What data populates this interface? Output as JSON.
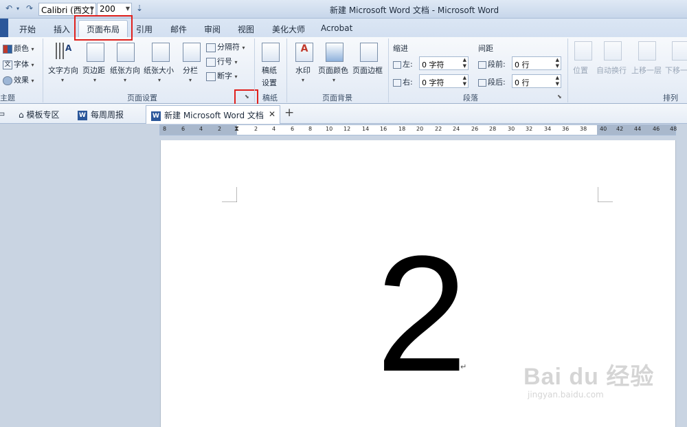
{
  "quick_access": {
    "undo_glyph": "↶",
    "undo_caret": "▾",
    "redo_glyph": "↷",
    "font_name": "Calibri (西文]",
    "font_size": "200",
    "customize_glyph": "⇣"
  },
  "window_title": "新建 Microsoft Word 文档 - Microsoft Word",
  "tabs": [
    "开始",
    "插入",
    "页面布局",
    "引用",
    "邮件",
    "审阅",
    "视图",
    "美化大师",
    "Acrobat"
  ],
  "ribbon": {
    "theme": {
      "colors": "颜色",
      "fonts": "字体",
      "effects": "效果",
      "label": "主题"
    },
    "page_setup": {
      "text_direction": "文字方向",
      "margins": "页边距",
      "orientation": "纸张方向",
      "size": "纸张大小",
      "columns": "分栏",
      "breaks": "分隔符",
      "line_numbers": "行号",
      "hyphenation": "断字",
      "label": "页面设置"
    },
    "manuscript": {
      "button_line1": "稿纸",
      "button_line2": "设置",
      "label": "稿纸"
    },
    "page_background": {
      "watermark": "水印",
      "page_color": "页面颜色",
      "page_borders": "页面边框",
      "label": "页面背景"
    },
    "paragraph": {
      "indent_title": "缩进",
      "left_label": "左:",
      "left_value": "0 字符",
      "right_label": "右:",
      "right_value": "0 字符",
      "spacing_title": "间距",
      "before_label": "段前:",
      "before_value": "0 行",
      "after_label": "段后:",
      "after_value": "0 行",
      "label": "段落"
    },
    "arrange": {
      "position": "位置",
      "wrap_text": "自动换行",
      "bring_forward": "上移一层",
      "send_backward": "下移一",
      "label": "排列"
    }
  },
  "doc_tabs": {
    "templates": "模板专区",
    "weekly": "每周周报",
    "active": "新建 Microsoft Word 文档",
    "close": "✕",
    "add": "+"
  },
  "ruler_numbers": [
    "8",
    "6",
    "4",
    "2",
    "2",
    "4",
    "6",
    "8",
    "10",
    "12",
    "14",
    "16",
    "18",
    "20",
    "22",
    "24",
    "26",
    "28",
    "30",
    "32",
    "34",
    "36",
    "38",
    "40",
    "42",
    "44",
    "46",
    "48"
  ],
  "document": {
    "content": "2",
    "paragraph_mark": "↵"
  },
  "watermark": {
    "brand": "Bai du 经验",
    "url": "jingyan.baidu.com"
  }
}
